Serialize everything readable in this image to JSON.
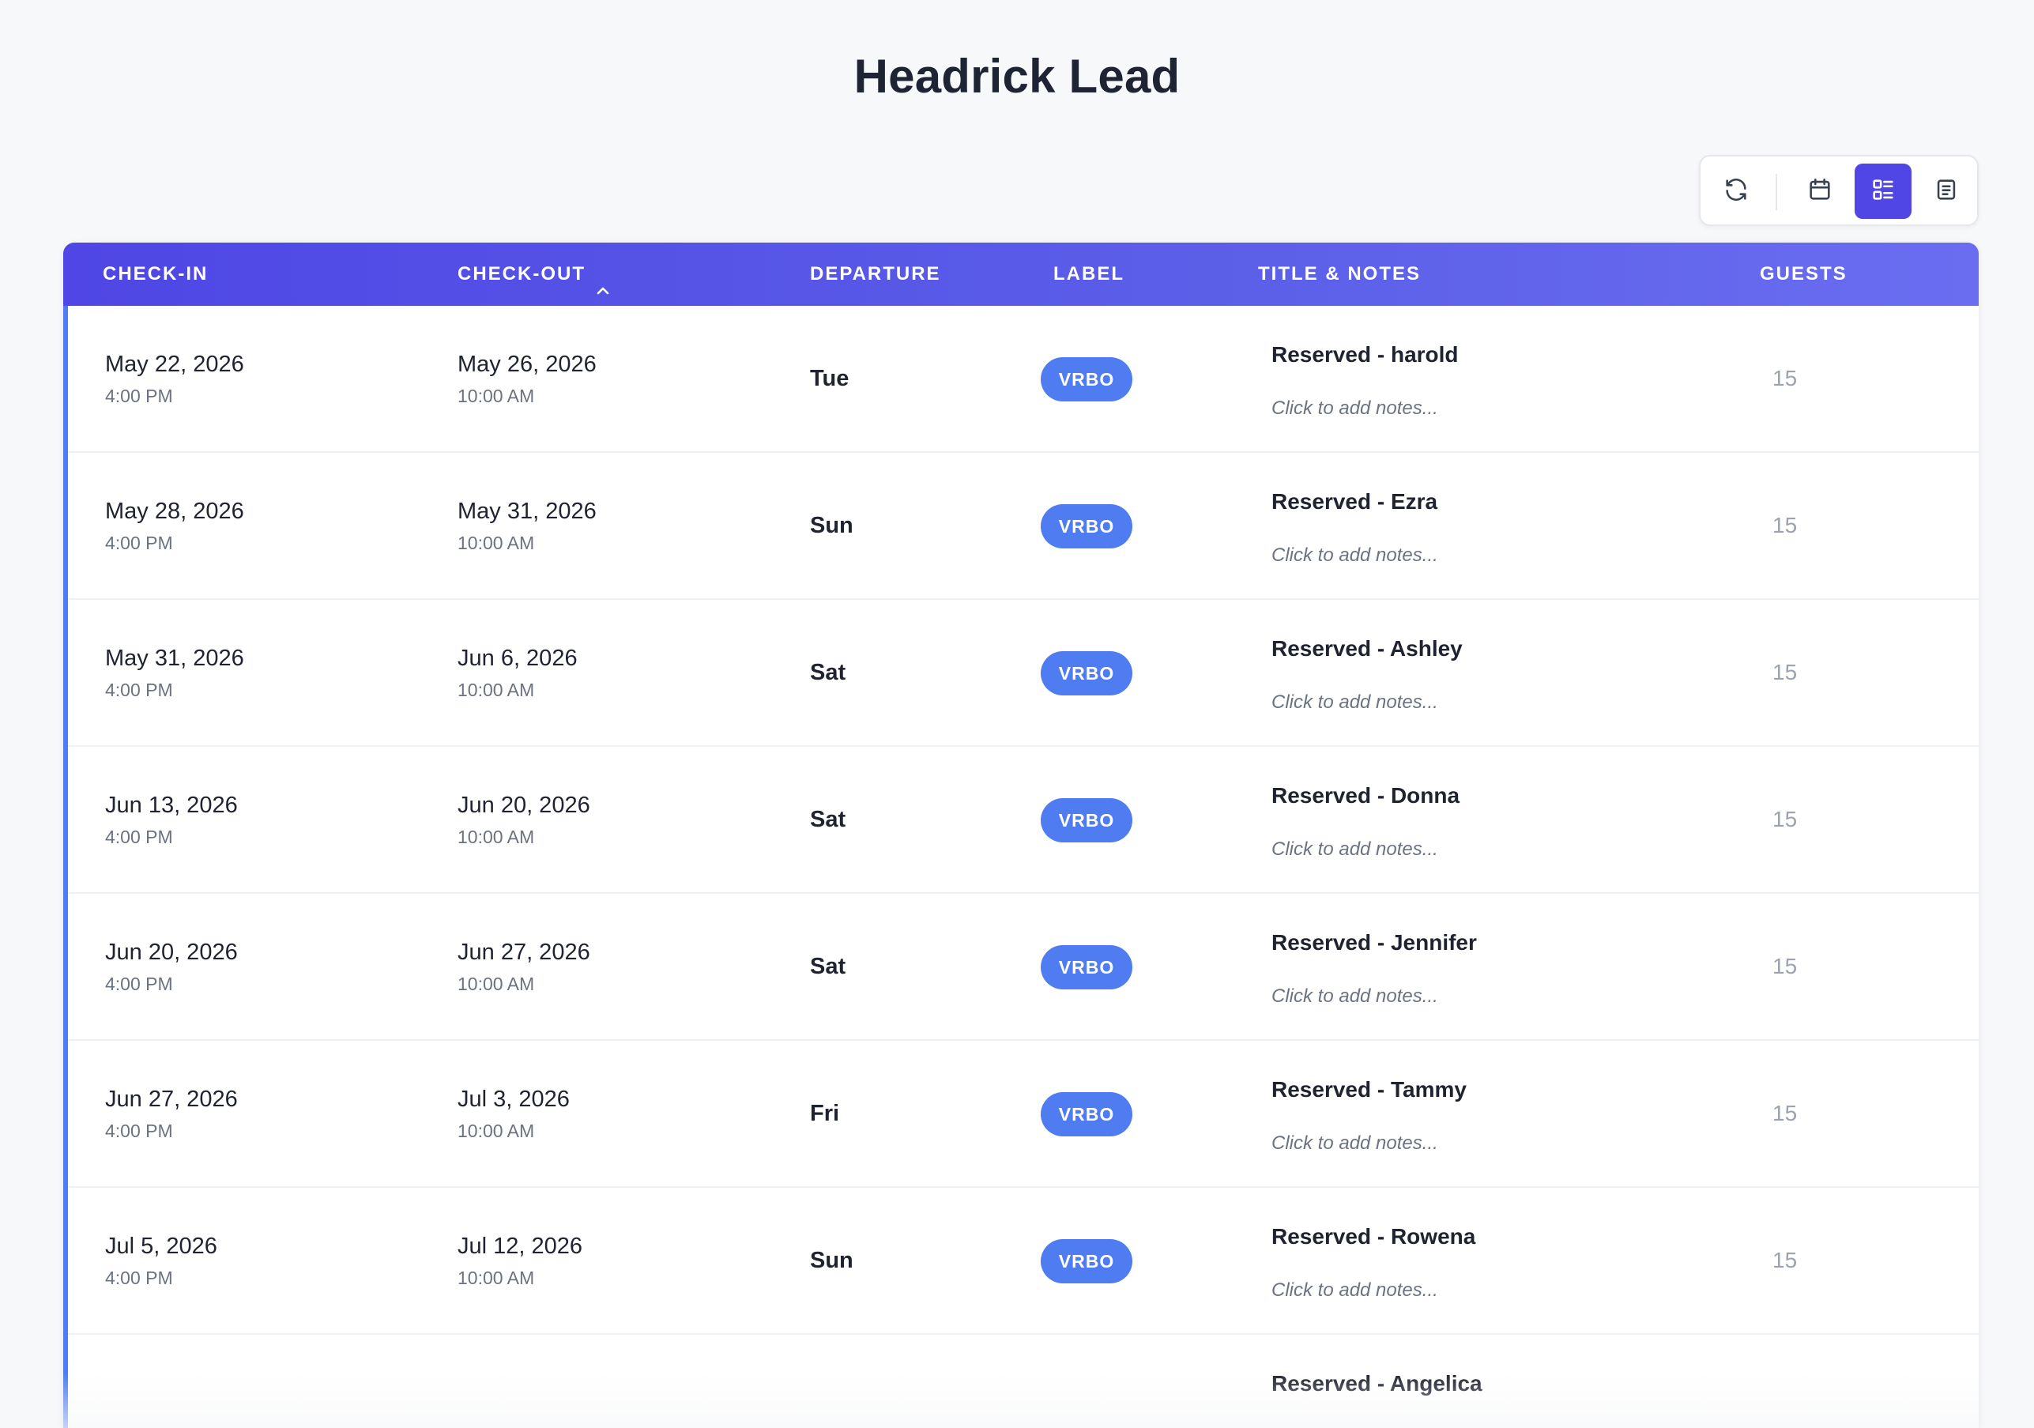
{
  "page": {
    "title": "Headrick Lead"
  },
  "toolbar": {
    "buttons": [
      {
        "icon": "refresh-icon"
      },
      {
        "icon": "calendar-icon"
      },
      {
        "icon": "list-view-icon",
        "active": true
      },
      {
        "icon": "notes-view-icon"
      }
    ]
  },
  "table": {
    "headers": {
      "checkin": "CHECK-IN",
      "checkout": "CHECK-OUT",
      "departure": "DEPARTURE",
      "label": "LABEL",
      "title_notes": "TITLE & NOTES",
      "guests": "GUESTS"
    },
    "sort": {
      "column": "checkout",
      "direction": "ascending",
      "icon": "chevron-up-icon"
    },
    "rows": [
      {
        "checkin_date": "May 22, 2026",
        "checkin_time": "4:00 PM",
        "checkout_date": "May 26, 2026",
        "checkout_time": "10:00 AM",
        "departure": "Tue",
        "label": "VRBO",
        "title": "Reserved - harold",
        "notes": "Click to add notes...",
        "guests": "15"
      },
      {
        "checkin_date": "May 28, 2026",
        "checkin_time": "4:00 PM",
        "checkout_date": "May 31, 2026",
        "checkout_time": "10:00 AM",
        "departure": "Sun",
        "label": "VRBO",
        "title": "Reserved - Ezra",
        "notes": "Click to add notes...",
        "guests": "15"
      },
      {
        "checkin_date": "May 31, 2026",
        "checkin_time": "4:00 PM",
        "checkout_date": "Jun 6, 2026",
        "checkout_time": "10:00 AM",
        "departure": "Sat",
        "label": "VRBO",
        "title": "Reserved - Ashley",
        "notes": "Click to add notes...",
        "guests": "15"
      },
      {
        "checkin_date": "Jun 13, 2026",
        "checkin_time": "4:00 PM",
        "checkout_date": "Jun 20, 2026",
        "checkout_time": "10:00 AM",
        "departure": "Sat",
        "label": "VRBO",
        "title": "Reserved - Donna",
        "notes": "Click to add notes...",
        "guests": "15"
      },
      {
        "checkin_date": "Jun 20, 2026",
        "checkin_time": "4:00 PM",
        "checkout_date": "Jun 27, 2026",
        "checkout_time": "10:00 AM",
        "departure": "Sat",
        "label": "VRBO",
        "title": "Reserved - Jennifer",
        "notes": "Click to add notes...",
        "guests": "15"
      },
      {
        "checkin_date": "Jun 27, 2026",
        "checkin_time": "4:00 PM",
        "checkout_date": "Jul 3, 2026",
        "checkout_time": "10:00 AM",
        "departure": "Fri",
        "label": "VRBO",
        "title": "Reserved - Tammy",
        "notes": "Click to add notes...",
        "guests": "15"
      },
      {
        "checkin_date": "Jul 5, 2026",
        "checkin_time": "4:00 PM",
        "checkout_date": "Jul 12, 2026",
        "checkout_time": "10:00 AM",
        "departure": "Sun",
        "label": "VRBO",
        "title": "Reserved - Rowena",
        "notes": "Click to add notes...",
        "guests": "15"
      },
      {
        "title": "Reserved - Angelica"
      }
    ]
  },
  "colors": {
    "header_gradient_start": "#4f46e5",
    "header_gradient_end": "#6a6df0",
    "badge": "#4f7cf0",
    "accent_bar": "#4f7cf0",
    "active_toggle": "#4f46e5"
  }
}
